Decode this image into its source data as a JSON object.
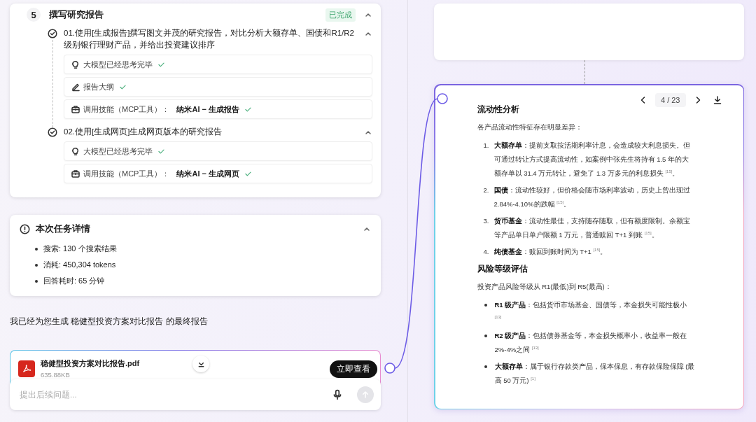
{
  "step": {
    "number": "5",
    "title": "撰写研究报告",
    "status": "已完成",
    "expanded": true,
    "tasks": [
      {
        "title": "01.使用[生成报告]撰写图文并茂的研究报告，对比分析大额存单、国债和R1/R2级别银行理财产品，并给出投资建议排序",
        "done": true,
        "expanded": true,
        "items": [
          {
            "kind": "think",
            "text": "大模型已经思考完毕",
            "done": true
          },
          {
            "kind": "outline",
            "text": "报告大纲",
            "done": true
          },
          {
            "kind": "tool",
            "text": "调用技能（MCP工具）：",
            "tool": "纳米AI − 生成报告",
            "done": true
          }
        ]
      },
      {
        "title": "02.使用[生成网页]生成网页版本的研究报告",
        "done": true,
        "expanded": true,
        "items": [
          {
            "kind": "think",
            "text": "大模型已经思考完毕",
            "done": true
          },
          {
            "kind": "tool",
            "text": "调用技能（MCP工具）：",
            "tool": "纳米AI − 生成网页",
            "done": true
          }
        ]
      }
    ]
  },
  "task_details": {
    "title": "本次任务详情",
    "expanded": true,
    "items": [
      "搜索: 130 个搜索结果",
      "消耗: 450,304 tokens",
      "回答耗时: 65 分钟"
    ]
  },
  "message": "我已经为您生成 稳健型投资方案对比报告 的最终报告",
  "attachment": {
    "name": "稳健型投资方案对比报告.pdf",
    "size": "635.88KB",
    "button": "立即查看"
  },
  "composer": {
    "placeholder": "提出后续问题..."
  },
  "preview": {
    "page": "4 / 23",
    "blocks": [
      {
        "kind": "heading",
        "text": "流动性分析"
      },
      {
        "kind": "paragraph",
        "text": "各产品流动性特征存在明显差异："
      },
      {
        "kind": "ol",
        "items": [
          {
            "number": "1.",
            "text": "**大额存单**：提前支取按活期利率计息，会造成较大利息损失。但可通过转让方式提高流动性，如案例中张先生将持有 1.5 年的大额存单以 31.4 万元转让，避免了 1.3 万多元的利息损失 $^{[15]}$。"
          },
          {
            "number": "2.",
            "text": "**国债**：流动性较好，但价格会随市场利率波动，历史上曾出现过 2.84%-4.10%的跌幅 $^{[15]}$。"
          },
          {
            "number": "3.",
            "text": "**货币基金**：流动性最佳，支持随存随取，但有额度限制。余额宝等产品单日单户限额 1 万元，普通赎回 T+1 到账 $^{[15]}$。"
          },
          {
            "number": "4.",
            "text": "**纯债基金**：赎回到账时间为 T+1 $^{[15]}$。"
          }
        ]
      },
      {
        "kind": "heading",
        "text": "风险等级评估"
      },
      {
        "kind": "paragraph",
        "text": "投资产品风险等级从 R1(最低)到 R5(最高)："
      },
      {
        "kind": "ul",
        "items": [
          "**R1 级产品**：包括货币市场基金、国债等，本金损失可能性极小 $^{[13]}$",
          "**R2 级产品**：包括债券基金等，本金损失概率小，收益率一般在 2%-4%之间 $^{[13]}$",
          "**大额存单**：属于银行存款类产品，保本保息，有存款保险保障 (最高 50 万元) $^{[1]}$"
        ]
      }
    ]
  }
}
